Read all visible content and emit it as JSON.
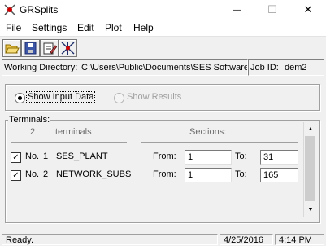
{
  "window": {
    "title": "GRSplits",
    "minimize_glyph": "—",
    "maximize_glyph": "☐",
    "close_glyph": "✕"
  },
  "menu": [
    "File",
    "Settings",
    "Edit",
    "Plot",
    "Help"
  ],
  "toolbar": {
    "buttons": [
      "open-folder-icon",
      "save-icon",
      "edit-icon",
      "run-icon"
    ]
  },
  "info": {
    "working_dir_label": "Working Directory:",
    "working_dir_value": "C:\\Users\\Public\\Documents\\SES Software",
    "job_id_label": "Job ID:",
    "job_id_value": "dem2"
  },
  "view_mode": {
    "show_input": "Show Input Data",
    "show_results": "Show Results",
    "selected": "show_input"
  },
  "terminals": {
    "group_label": "Terminals:",
    "count": "2",
    "count_label": "terminals",
    "sections_label": "Sections:",
    "from_label": "From:",
    "to_label": "To:",
    "rows": [
      {
        "checked": true,
        "no_label": "No.",
        "no": "1",
        "name": "SES_PLANT",
        "from": "1",
        "to": "31"
      },
      {
        "checked": true,
        "no_label": "No.",
        "no": "2",
        "name": "NETWORK_SUBS",
        "from": "1",
        "to": "165"
      }
    ]
  },
  "status": {
    "text": "Ready.",
    "date": "4/25/2016",
    "time": "4:14 PM"
  },
  "colors": {
    "panel": "#f0f0f0",
    "focus_dotted": "#000000",
    "disabled_text": "#a0a0a0"
  }
}
